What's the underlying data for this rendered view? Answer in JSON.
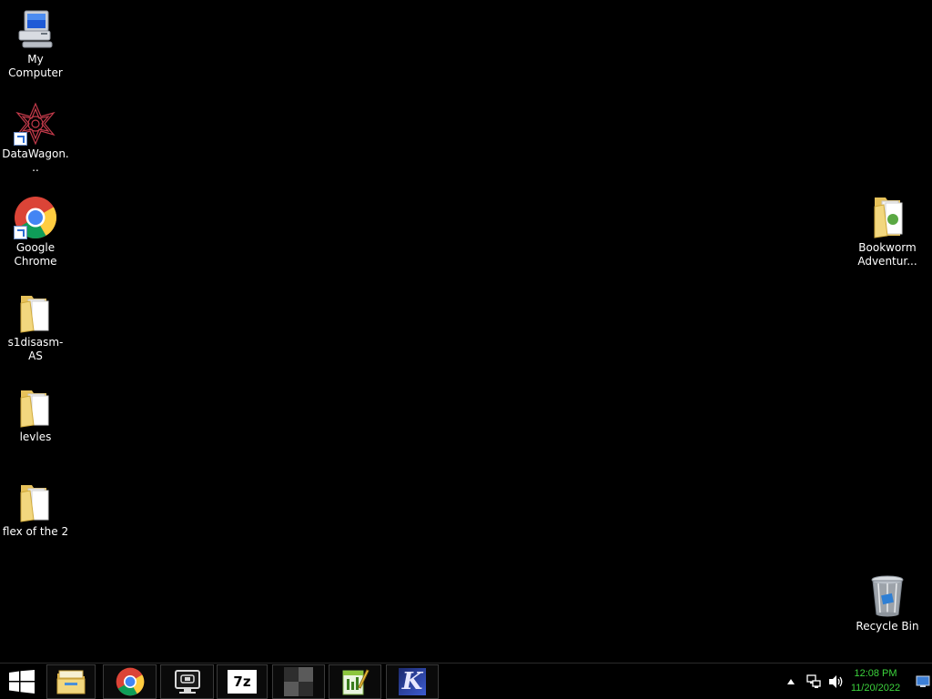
{
  "desktop": {
    "icons": [
      {
        "label": "My Computer",
        "icon": "my-computer-icon"
      },
      {
        "label": "DataWagon...",
        "icon": "datawagon-icon"
      },
      {
        "label": "Google Chrome",
        "icon": "chrome-icon"
      },
      {
        "label": "s1disasm-AS",
        "icon": "folder-icon"
      },
      {
        "label": "levles",
        "icon": "folder-icon"
      },
      {
        "label": "flex of the 2",
        "icon": "folder-icon"
      },
      {
        "label": "Bookworm Adventur...",
        "icon": "folder-icon"
      },
      {
        "label": "Recycle Bin",
        "icon": "recycle-bin-icon"
      }
    ]
  },
  "taskbar": {
    "start_icon": "windows-logo-icon",
    "pinned": [
      {
        "icon": "file-explorer-icon"
      },
      {
        "icon": "chrome-icon"
      },
      {
        "icon": "monitor-app-icon"
      },
      {
        "icon": "7zip-icon",
        "text": "7z"
      },
      {
        "icon": "checkered-app-icon"
      },
      {
        "icon": "notepadpp-icon"
      },
      {
        "icon": "k-app-icon",
        "text": "K"
      }
    ],
    "tray": {
      "time": "12:08 PM",
      "date": "11/20/2022",
      "clock_color": "#3cd43c"
    }
  }
}
